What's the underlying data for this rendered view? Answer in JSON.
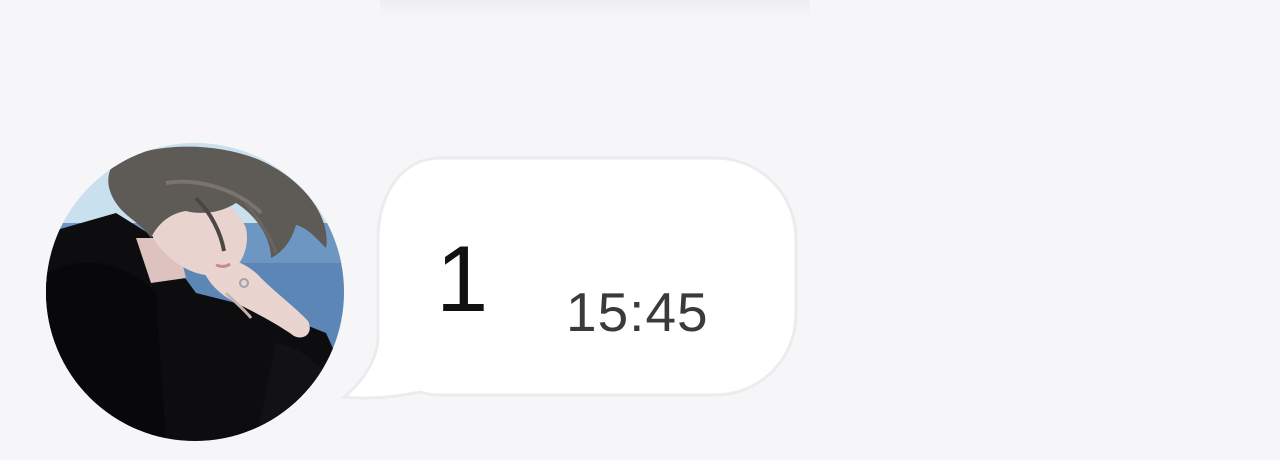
{
  "chat": {
    "messages": [
      {
        "direction": "incoming",
        "text": "1",
        "time": "15:45",
        "avatar": {
          "icon": "contact-avatar-photo",
          "colors": {
            "sky": "#c9e0ee",
            "sea": "#5b86b5",
            "hair": "#5e5a55",
            "skin": "#e8d3cf",
            "clothing": "#0d0d10"
          }
        },
        "bubble_color": "#ffffff"
      }
    ]
  },
  "colors": {
    "background": "#f6f6f8",
    "bubble_border": "#ececee",
    "text": "#111111",
    "time": "#3a3a3c"
  }
}
